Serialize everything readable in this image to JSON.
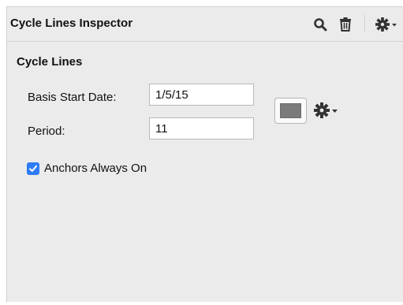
{
  "inspector": {
    "title": "Cycle Lines Inspector",
    "toolbar": {
      "search_icon": "search-icon",
      "delete_icon": "trash-icon",
      "settings_icon": "gear-menu-icon"
    }
  },
  "section": {
    "title": "Cycle Lines",
    "basis_start_date": {
      "label": "Basis Start Date:",
      "value": "1/5/15"
    },
    "period": {
      "label": "Period:",
      "value": "11"
    },
    "line_color": "#7a7a7a",
    "action_icon": "gear-menu-icon",
    "anchors_always_on": {
      "label": "Anchors Always On",
      "checked": true
    }
  },
  "colors": {
    "panel_background": "#ebebeb",
    "accent": "#2d7cf6",
    "icon": "#333333"
  }
}
